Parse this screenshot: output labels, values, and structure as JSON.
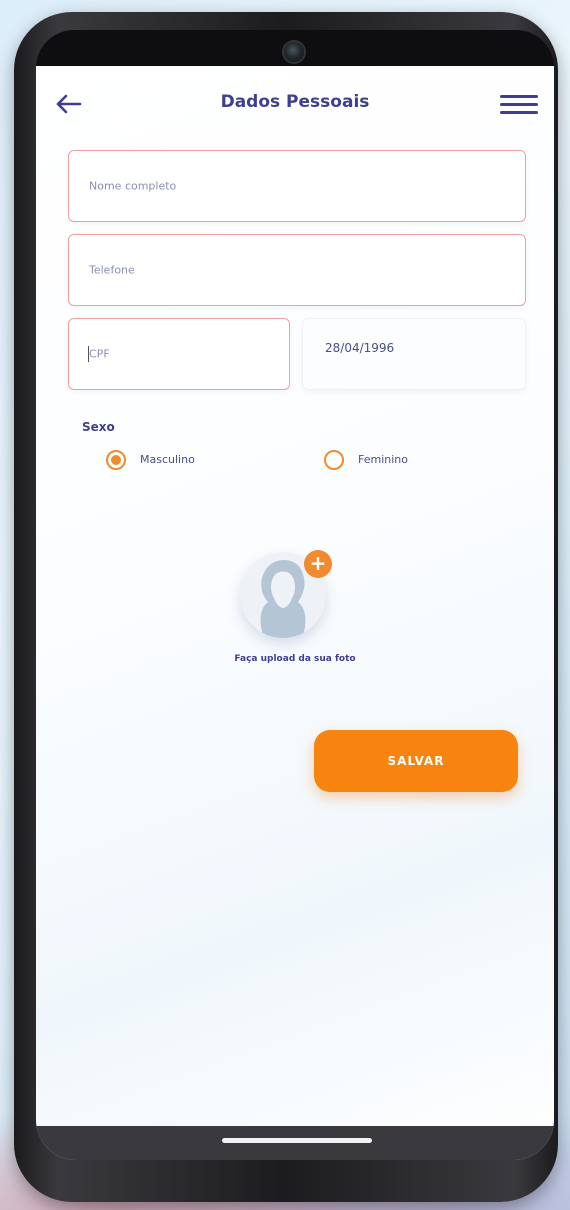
{
  "header": {
    "title": "Dados Pessoais",
    "back_icon": "arrow-left-icon",
    "menu_icon": "hamburger-menu-icon"
  },
  "form": {
    "nome_placeholder": "Nome completo",
    "telefone_placeholder": "Telefone",
    "cpf_placeholder": "CPF",
    "data_nascimento_value": "28/04/1996"
  },
  "gender": {
    "label": "Sexo",
    "options": [
      {
        "label": "Masculino",
        "selected": true
      },
      {
        "label": "Feminino",
        "selected": false
      }
    ]
  },
  "photo": {
    "upload_label": "Faça upload da sua foto",
    "add_icon": "plus-icon"
  },
  "actions": {
    "save_label": "SALVAR"
  },
  "colors": {
    "primary": "#3f3f8f",
    "accent": "#f6840f",
    "field_border": "#f0a0a0"
  }
}
